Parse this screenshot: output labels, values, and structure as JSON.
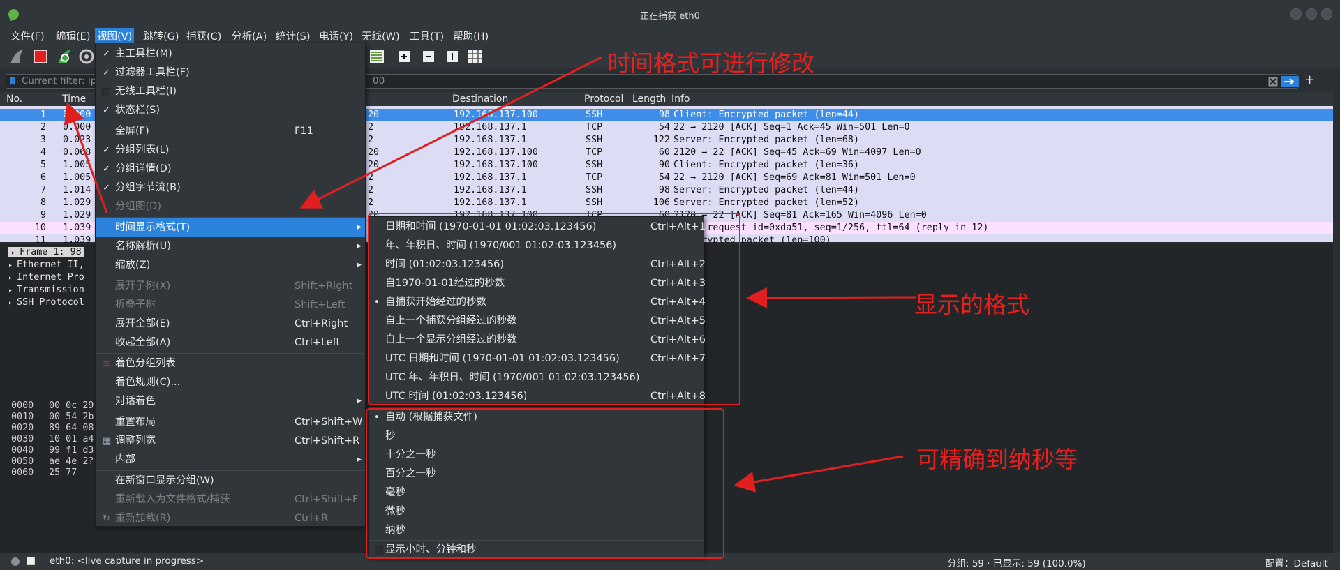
{
  "window": {
    "title": "正在捕获 eth0"
  },
  "menubar": [
    "文件(F)",
    "编辑(E)",
    "视图(V)",
    "跳转(G)",
    "捕获(C)",
    "分析(A)",
    "统计(S)",
    "电话(Y)",
    "无线(W)",
    "工具(T)",
    "帮助(H)"
  ],
  "filter": {
    "placeholder": "Current filter: ip",
    "tail": "00"
  },
  "columns": [
    "No.",
    "Time",
    "Destination",
    "Protocol",
    "Length",
    "Info"
  ],
  "packets": [
    {
      "no": "1",
      "time": "0.000",
      "src_tail": "20",
      "dst": "192.168.137.100",
      "proto": "SSH",
      "len": "98",
      "info": "Client: Encrypted packet (len=44)"
    },
    {
      "no": "2",
      "time": "0.000",
      "src_tail": "2",
      "dst": "192.168.137.1",
      "proto": "TCP",
      "len": "54",
      "info": "22 → 2120 [ACK] Seq=1 Ack=45 Win=501 Len=0"
    },
    {
      "no": "3",
      "time": "0.023",
      "src_tail": "2",
      "dst": "192.168.137.1",
      "proto": "SSH",
      "len": "122",
      "info": "Server: Encrypted packet (len=68)"
    },
    {
      "no": "4",
      "time": "0.068",
      "src_tail": "20",
      "dst": "192.168.137.100",
      "proto": "TCP",
      "len": "60",
      "info": "2120 → 22 [ACK] Seq=45 Ack=69 Win=4097 Len=0"
    },
    {
      "no": "5",
      "time": "1.005",
      "src_tail": "20",
      "dst": "192.168.137.100",
      "proto": "SSH",
      "len": "90",
      "info": "Client: Encrypted packet (len=36)"
    },
    {
      "no": "6",
      "time": "1.005",
      "src_tail": "2",
      "dst": "192.168.137.1",
      "proto": "TCP",
      "len": "54",
      "info": "22 → 2120 [ACK] Seq=69 Ack=81 Win=501 Len=0"
    },
    {
      "no": "7",
      "time": "1.014",
      "src_tail": "2",
      "dst": "192.168.137.1",
      "proto": "SSH",
      "len": "98",
      "info": "Server: Encrypted packet (len=44)"
    },
    {
      "no": "8",
      "time": "1.029",
      "src_tail": "2",
      "dst": "192.168.137.1",
      "proto": "SSH",
      "len": "106",
      "info": "Server: Encrypted packet (len=52)"
    },
    {
      "no": "9",
      "time": "1.029",
      "src_tail": "20",
      "dst": "192.168.137.100",
      "proto": "TCP",
      "len": "60",
      "info": "2120 → 22 [ACK] Seq=81 Ack=165 Win=4096 Len=0"
    },
    {
      "no": "10",
      "time": "1.039",
      "src_tail": "",
      "dst": "",
      "proto": "",
      "len": "",
      "info": "ping) request  id=0xda51, seq=1/256, ttl=64 (reply in 12)"
    },
    {
      "no": "11",
      "time": "1.039",
      "src_tail": "",
      "dst": "",
      "proto": "",
      "len": "",
      "info": ": Encrypted packet (len=100)"
    }
  ],
  "details": [
    "Frame 1: 98",
    "Ethernet II,",
    "Internet Pro",
    "Transmission",
    "SSH Protocol"
  ],
  "bytes": {
    "offsets": [
      "0000",
      "0010",
      "0020",
      "0030",
      "0040",
      "0050",
      "0060"
    ],
    "hex": [
      "00 0c 29",
      "00 54 2b",
      "89 64 08",
      "10 01 a4",
      "99 f1 d3",
      "ae 4e 2?",
      "25 77"
    ]
  },
  "view_menu": [
    {
      "label": "主工具栏(M)",
      "checked": true
    },
    {
      "label": "过滤器工具栏(F)",
      "checked": true
    },
    {
      "label": "无线工具栏(I)",
      "checked": false
    },
    {
      "label": "状态栏(S)",
      "checked": true
    },
    {
      "label": "全屏(F)",
      "shortcut": "F11"
    },
    {
      "label": "分组列表(L)",
      "checked": true
    },
    {
      "label": "分组详情(D)",
      "checked": true
    },
    {
      "label": "分组字节流(B)",
      "checked": true
    },
    {
      "label": "分组图(D)",
      "disabled": true
    },
    {
      "label": "时间显示格式(T)",
      "submenu": true,
      "highlight": true
    },
    {
      "label": "名称解析(U)",
      "submenu": true
    },
    {
      "label": "缩放(Z)",
      "submenu": true
    },
    {
      "label": "展开子树(X)",
      "shortcut": "Shift+Right",
      "disabled": true
    },
    {
      "label": "折叠子树",
      "shortcut": "Shift+Left",
      "disabled": true
    },
    {
      "label": "展开全部(E)",
      "shortcut": "Ctrl+Right"
    },
    {
      "label": "收起全部(A)",
      "shortcut": "Ctrl+Left"
    },
    {
      "label": "着色分组列表"
    },
    {
      "label": "着色规则(C)..."
    },
    {
      "label": "对话着色",
      "submenu": true
    },
    {
      "label": "重置布局",
      "shortcut": "Ctrl+Shift+W"
    },
    {
      "label": "调整列宽",
      "shortcut": "Ctrl+Shift+R"
    },
    {
      "label": "内部",
      "submenu": true
    },
    {
      "label": "在新窗口显示分组(W)"
    },
    {
      "label": "重新载入为文件格式/捕获",
      "shortcut": "Ctrl+Shift+F",
      "disabled": true
    },
    {
      "label": "重新加载(R)",
      "shortcut": "Ctrl+R",
      "disabled": true
    }
  ],
  "time_menu": [
    {
      "label": "日期和时间 (1970-01-01 01:02:03.123456)",
      "shortcut": "Ctrl+Alt+1"
    },
    {
      "label": "年、年积日、时间 (1970/001 01:02:03.123456)",
      "shortcut": ""
    },
    {
      "label": "时间 (01:02:03.123456)",
      "shortcut": "Ctrl+Alt+2"
    },
    {
      "label": "自1970-01-01经过的秒数",
      "shortcut": "Ctrl+Alt+3"
    },
    {
      "label": "自捕获开始经过的秒数",
      "shortcut": "Ctrl+Alt+4",
      "selected": true
    },
    {
      "label": "自上一个捕获分组经过的秒数",
      "shortcut": "Ctrl+Alt+5"
    },
    {
      "label": "自上一个显示分组经过的秒数",
      "shortcut": "Ctrl+Alt+6"
    },
    {
      "label": "UTC 日期和时间 (1970-01-01 01:02:03.123456)",
      "shortcut": "Ctrl+Alt+7"
    },
    {
      "label": "UTC 年、年积日、时间 (1970/001 01:02:03.123456)",
      "shortcut": ""
    },
    {
      "label": "UTC 时间 (01:02:03.123456)",
      "shortcut": "Ctrl+Alt+8"
    }
  ],
  "precision_menu": [
    {
      "label": "自动 (根据捕获文件)",
      "selected": true
    },
    {
      "label": "秒"
    },
    {
      "label": "十分之一秒"
    },
    {
      "label": "百分之一秒"
    },
    {
      "label": "毫秒"
    },
    {
      "label": "微秒"
    },
    {
      "label": "纳秒"
    }
  ],
  "show_hms": "显示小时、分钟和秒",
  "annotations": {
    "top": "时间格式可进行修改",
    "middle": "显示的格式",
    "bottom": "可精确到纳秒等"
  },
  "status": {
    "left": "eth0: <live capture in progress>",
    "packets": "分组: 59 · 已显示: 59 (100.0%)",
    "profile": "配置：Default"
  },
  "colors": {
    "accent": "#2a82da",
    "annotation": "#e0201e",
    "selected_row": "#3d8de9",
    "list_bg": "#dcdcf5",
    "icmp_row": "#fce0ff"
  }
}
